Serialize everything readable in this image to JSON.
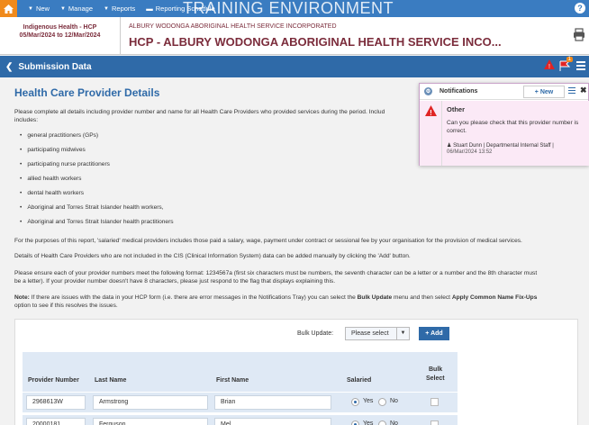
{
  "topnav": {
    "new_label": "New",
    "manage_label": "Manage",
    "reports_label": "Reports",
    "reporting_label": "Reporting Schedule",
    "training_banner": "TRAINING ENVIRONMENT"
  },
  "header": {
    "program": "Indigenous Health - HCP",
    "period": "05/Mar/2024 to 12/Mar/2024",
    "org_small": "ALBURY WODONGA ABORIGINAL HEALTH SERVICE INCORPORATED",
    "title": "HCP - ALBURY WODONGA ABORIGINAL HEALTH SERVICE INCO..."
  },
  "subbar": {
    "label": "Submission Data",
    "badge_count": "1"
  },
  "content": {
    "title": "Health Care Provider Details",
    "intro": "Please complete all details including provider number and name for all Health Care Providers who provided services during the period. Includ",
    "intro2": "includes:",
    "bullets": [
      "general practitioners (GPs)",
      "participating midwives",
      "participating nurse practitioners",
      "allied health workers",
      "dental health workers",
      "Aboriginal and Torres Strait Islander health workers,",
      "Aboriginal and Torres Strait Islander health practitioners"
    ],
    "para_salaried": "For the purposes of this report, 'salaried' medical providers includes those paid a salary, wage, payment under contract or sessional fee by your organisation for the provision of medical services.",
    "para_cis": "Details of Health Care Providers who are not included in the CIS (Clinical Information System) data can be added manually by clicking the 'Add' button.",
    "para_format1": "Please ensure each of your provider numbers meet the following format: 1234567a (first six characters must be numbers, the seventh character can be a letter or a number and the 8th character must",
    "para_format2": "be a letter). If your provider number doesn't have 8 characters, please just respond to the flag that displays explaining this.",
    "note_label": "Note:",
    "note_text1": " If there are issues with the data in your HCP form (i.e. there are error messages in the Notifications Tray) you can select the ",
    "note_bulk": "Bulk Update",
    "note_text2": " menu and then select ",
    "note_apply": "Apply Common Name Fix-Ups",
    "note_text3": "option to see if this resolves the issues."
  },
  "table": {
    "bulk_label": "Bulk Update:",
    "bulk_select": "Please select",
    "add_label": "+ Add",
    "headers": {
      "provider_number": "Provider Number",
      "last_name": "Last Name",
      "first_name": "First Name",
      "salaried": "Salaried",
      "bulk_select_1": "Bulk",
      "bulk_select_2": "Select"
    },
    "rows": [
      {
        "provider_number": "2968613W",
        "last_name": "Armstrong",
        "first_name": "Brian",
        "salaried": "Yes"
      },
      {
        "provider_number": "20000181",
        "last_name": "Ferguson",
        "first_name": "Mel",
        "salaried": "Yes"
      }
    ],
    "yes_label": "Yes",
    "no_label": "No"
  },
  "notifications": {
    "title": "Notifications",
    "new_label": "+ New",
    "type": "Other",
    "message_1": "Can you please check that this provider number is",
    "message_2": "correct.",
    "author": "Stuart Dunn | Departmental Internal Staff |",
    "date": "06/Mar/2024 13:52"
  },
  "colors": {
    "nav_blue": "#3a7cc1",
    "home_orange": "#f08a1c",
    "maroon": "#7b2c3b",
    "notif_pink": "#fbe9f6"
  }
}
